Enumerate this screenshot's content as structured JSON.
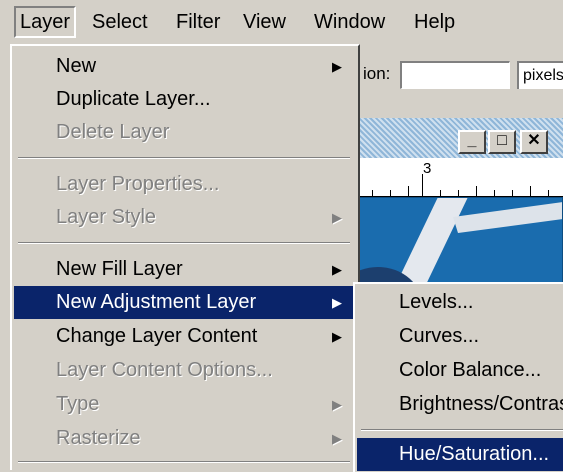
{
  "menubar": {
    "items": [
      {
        "label": "Layer",
        "active": true
      },
      {
        "label": "Select"
      },
      {
        "label": "Filter"
      },
      {
        "label": "View"
      },
      {
        "label": "Window"
      },
      {
        "label": "Help"
      }
    ]
  },
  "options_bar": {
    "label": "ion:",
    "input_value": "",
    "unit": "pixels"
  },
  "document": {
    "ruler_label": "3",
    "buttons": {
      "minimize": "_",
      "maximize": "□",
      "close": "✕"
    }
  },
  "layer_menu": {
    "items": [
      {
        "label": "New",
        "enabled": true,
        "submenu": true
      },
      {
        "label": "Duplicate Layer...",
        "enabled": true
      },
      {
        "label": "Delete Layer",
        "enabled": false
      },
      {
        "label": "Layer Properties...",
        "enabled": false
      },
      {
        "label": "Layer Style",
        "enabled": false,
        "submenu": true
      },
      {
        "label": "New Fill Layer",
        "enabled": true,
        "submenu": true
      },
      {
        "label": "New Adjustment Layer",
        "enabled": true,
        "submenu": true,
        "highlighted": true
      },
      {
        "label": "Change Layer Content",
        "enabled": true,
        "submenu": true
      },
      {
        "label": "Layer Content Options...",
        "enabled": false
      },
      {
        "label": "Type",
        "enabled": false,
        "submenu": true
      },
      {
        "label": "Rasterize",
        "enabled": false,
        "submenu": true
      }
    ]
  },
  "adjustment_submenu": {
    "items": [
      {
        "label": "Levels..."
      },
      {
        "label": "Curves..."
      },
      {
        "label": "Color Balance..."
      },
      {
        "label": "Brightness/Contrast..."
      },
      {
        "label": "Hue/Saturation...",
        "highlighted": true
      }
    ]
  },
  "colors": {
    "menu_bg": "#d4d0c8",
    "highlight": "#0a246a",
    "disabled_text": "#808080",
    "canvas_blue": "#1568a8"
  }
}
